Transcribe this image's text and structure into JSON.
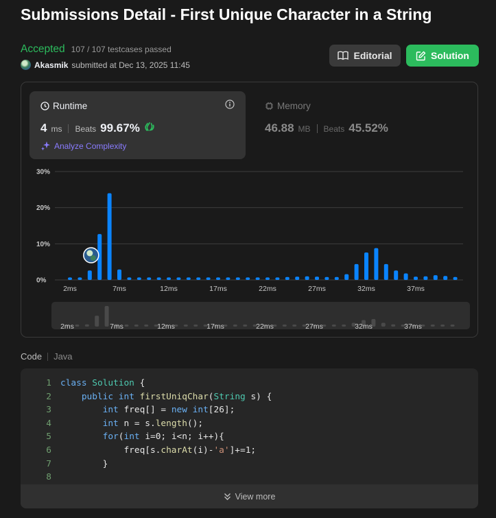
{
  "page": {
    "title": "Submissions Detail - First Unique Character in a String"
  },
  "status": {
    "verdict": "Accepted",
    "testcases": "107 / 107 testcases passed",
    "username": "Akasmik",
    "submitted": "submitted at Dec 13, 2025 11:45"
  },
  "buttons": {
    "editorial": "Editorial",
    "solution": "Solution"
  },
  "colors": {
    "accent_green": "#2cbb5d",
    "bar_blue": "#0a84ff",
    "analyze_purple": "#8a7cff"
  },
  "runtime": {
    "label": "Runtime",
    "value": "4",
    "unit": "ms",
    "beats_label": "Beats",
    "beats_value": "99.67%",
    "analyze_label": "Analyze Complexity"
  },
  "memory": {
    "label": "Memory",
    "value": "46.88",
    "unit": "MB",
    "beats_label": "Beats",
    "beats_value": "45.52%"
  },
  "chart_data": {
    "type": "bar",
    "title": "",
    "xlabel": "",
    "ylabel": "",
    "ylim": [
      0,
      30
    ],
    "ytick_labels": [
      "0%",
      "10%",
      "20%",
      "30%"
    ],
    "yticks": [
      0,
      10,
      20,
      30
    ],
    "xtick_labels": [
      "2ms",
      "7ms",
      "12ms",
      "17ms",
      "22ms",
      "27ms",
      "32ms",
      "37ms"
    ],
    "xticks": [
      2,
      7,
      12,
      17,
      22,
      27,
      32,
      37
    ],
    "grid": true,
    "highlight_x": 4,
    "x": [
      2,
      3,
      4,
      5,
      6,
      7,
      8,
      9,
      10,
      11,
      12,
      13,
      14,
      15,
      16,
      17,
      18,
      19,
      20,
      21,
      22,
      23,
      24,
      25,
      26,
      27,
      28,
      29,
      30,
      31,
      32,
      33,
      34,
      35,
      36,
      37,
      38,
      39,
      40,
      41
    ],
    "values": [
      0.7,
      0.7,
      2.6,
      12.7,
      24.0,
      2.9,
      0.7,
      0.7,
      0.7,
      0.7,
      0.7,
      0.7,
      0.7,
      0.7,
      0.7,
      0.7,
      0.7,
      0.7,
      0.7,
      0.7,
      0.7,
      0.7,
      0.8,
      0.9,
      1.0,
      0.9,
      0.8,
      0.8,
      1.6,
      4.4,
      7.6,
      8.8,
      4.4,
      2.6,
      1.8,
      0.9,
      1.0,
      1.3,
      1.1,
      0.8
    ]
  },
  "navigator": {
    "labels": [
      "2ms",
      "7ms",
      "12ms",
      "17ms",
      "22ms",
      "27ms",
      "32ms",
      "37ms"
    ]
  },
  "code": {
    "header": "Code",
    "language": "Java",
    "view_more": "View more",
    "lines": [
      "class Solution {",
      "    public int firstUniqChar(String s) {",
      "        int freq[] = new int[26];",
      "        int n = s.length();",
      "        for(int i=0; i<n; i++){",
      "            freq[s.charAt(i)-'a']+=1;",
      "        }",
      ""
    ],
    "line_numbers": [
      "1",
      "2",
      "3",
      "4",
      "5",
      "6",
      "7",
      "8"
    ]
  }
}
